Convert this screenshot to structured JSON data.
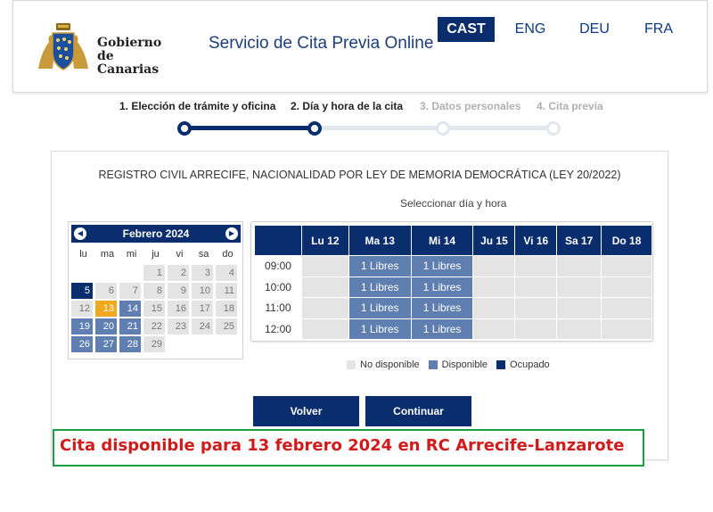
{
  "header": {
    "logo_line1": "Gobierno",
    "logo_line2": "de Canarias",
    "title": "Servicio de Cita Previa Online",
    "languages": [
      {
        "label": "CAST",
        "active": true
      },
      {
        "label": "ENG",
        "active": false
      },
      {
        "label": "DEU",
        "active": false
      },
      {
        "label": "FRA",
        "active": false
      }
    ]
  },
  "stepper": {
    "current_step": 2,
    "steps": [
      {
        "label": "1. Elección de trámite y oficina",
        "state": "done"
      },
      {
        "label": "2. Día y hora de la cita",
        "state": "current"
      },
      {
        "label": "3. Datos personales",
        "state": "todo"
      },
      {
        "label": "4. Cita previa",
        "state": "todo"
      }
    ]
  },
  "procedure_title": "REGISTRO CIVIL ARRECIFE, NACIONALIDAD POR LEY DE MEMORIA DEMOCRÁTICA (LEY 20/2022)",
  "select_hint": "Seleccionar día y hora",
  "calendar": {
    "month_label": "Febrero 2024",
    "prev_icon": "chevron-left-icon",
    "next_icon": "chevron-right-icon",
    "weekdays": [
      "lu",
      "ma",
      "mi",
      "ju",
      "vi",
      "sa",
      "do"
    ],
    "days": [
      {
        "n": "",
        "s": "empty"
      },
      {
        "n": "",
        "s": "empty"
      },
      {
        "n": "",
        "s": "empty"
      },
      {
        "n": "1",
        "s": "disabled"
      },
      {
        "n": "2",
        "s": "disabled"
      },
      {
        "n": "3",
        "s": "disabled"
      },
      {
        "n": "4",
        "s": "disabled"
      },
      {
        "n": "5",
        "s": "occupied"
      },
      {
        "n": "6",
        "s": "disabled"
      },
      {
        "n": "7",
        "s": "disabled"
      },
      {
        "n": "8",
        "s": "disabled"
      },
      {
        "n": "9",
        "s": "disabled"
      },
      {
        "n": "10",
        "s": "disabled"
      },
      {
        "n": "11",
        "s": "disabled"
      },
      {
        "n": "12",
        "s": "disabled"
      },
      {
        "n": "13",
        "s": "selected"
      },
      {
        "n": "14",
        "s": "available"
      },
      {
        "n": "15",
        "s": "disabled"
      },
      {
        "n": "16",
        "s": "disabled"
      },
      {
        "n": "17",
        "s": "disabled"
      },
      {
        "n": "18",
        "s": "disabled"
      },
      {
        "n": "19",
        "s": "available"
      },
      {
        "n": "20",
        "s": "available"
      },
      {
        "n": "21",
        "s": "available"
      },
      {
        "n": "22",
        "s": "disabled"
      },
      {
        "n": "23",
        "s": "disabled"
      },
      {
        "n": "24",
        "s": "disabled"
      },
      {
        "n": "25",
        "s": "disabled"
      },
      {
        "n": "26",
        "s": "available"
      },
      {
        "n": "27",
        "s": "available"
      },
      {
        "n": "28",
        "s": "available"
      },
      {
        "n": "29",
        "s": "disabled"
      }
    ]
  },
  "schedule": {
    "days": [
      "Lu 12",
      "Ma 13",
      "Mi 14",
      "Ju 15",
      "Vi 16",
      "Sa 17",
      "Do 18"
    ],
    "rows": [
      {
        "time": "09:00",
        "slots": [
          "",
          "1 Libres",
          "1 Libres",
          "",
          "",
          "",
          ""
        ]
      },
      {
        "time": "10:00",
        "slots": [
          "",
          "1 Libres",
          "1 Libres",
          "",
          "",
          "",
          ""
        ]
      },
      {
        "time": "11:00",
        "slots": [
          "",
          "1 Libres",
          "1 Libres",
          "",
          "",
          "",
          ""
        ]
      },
      {
        "time": "12:00",
        "slots": [
          "",
          "1 Libres",
          "1 Libres",
          "",
          "",
          "",
          ""
        ]
      }
    ]
  },
  "legend": {
    "not_available": "No disponible",
    "available": "Disponible",
    "occupied": "Ocupado"
  },
  "buttons": {
    "back": "Volver",
    "continue": "Continuar"
  },
  "note": "Cita disponible para 13 febrero 2024 en RC Arrecife-Lanzarote",
  "colors": {
    "primary": "#0a2d6e",
    "available": "#5e7fb0",
    "not_available": "#e4e4e4",
    "selected": "#f0a81c",
    "note_border": "#1a9f47",
    "note_text": "#d11a1a"
  }
}
